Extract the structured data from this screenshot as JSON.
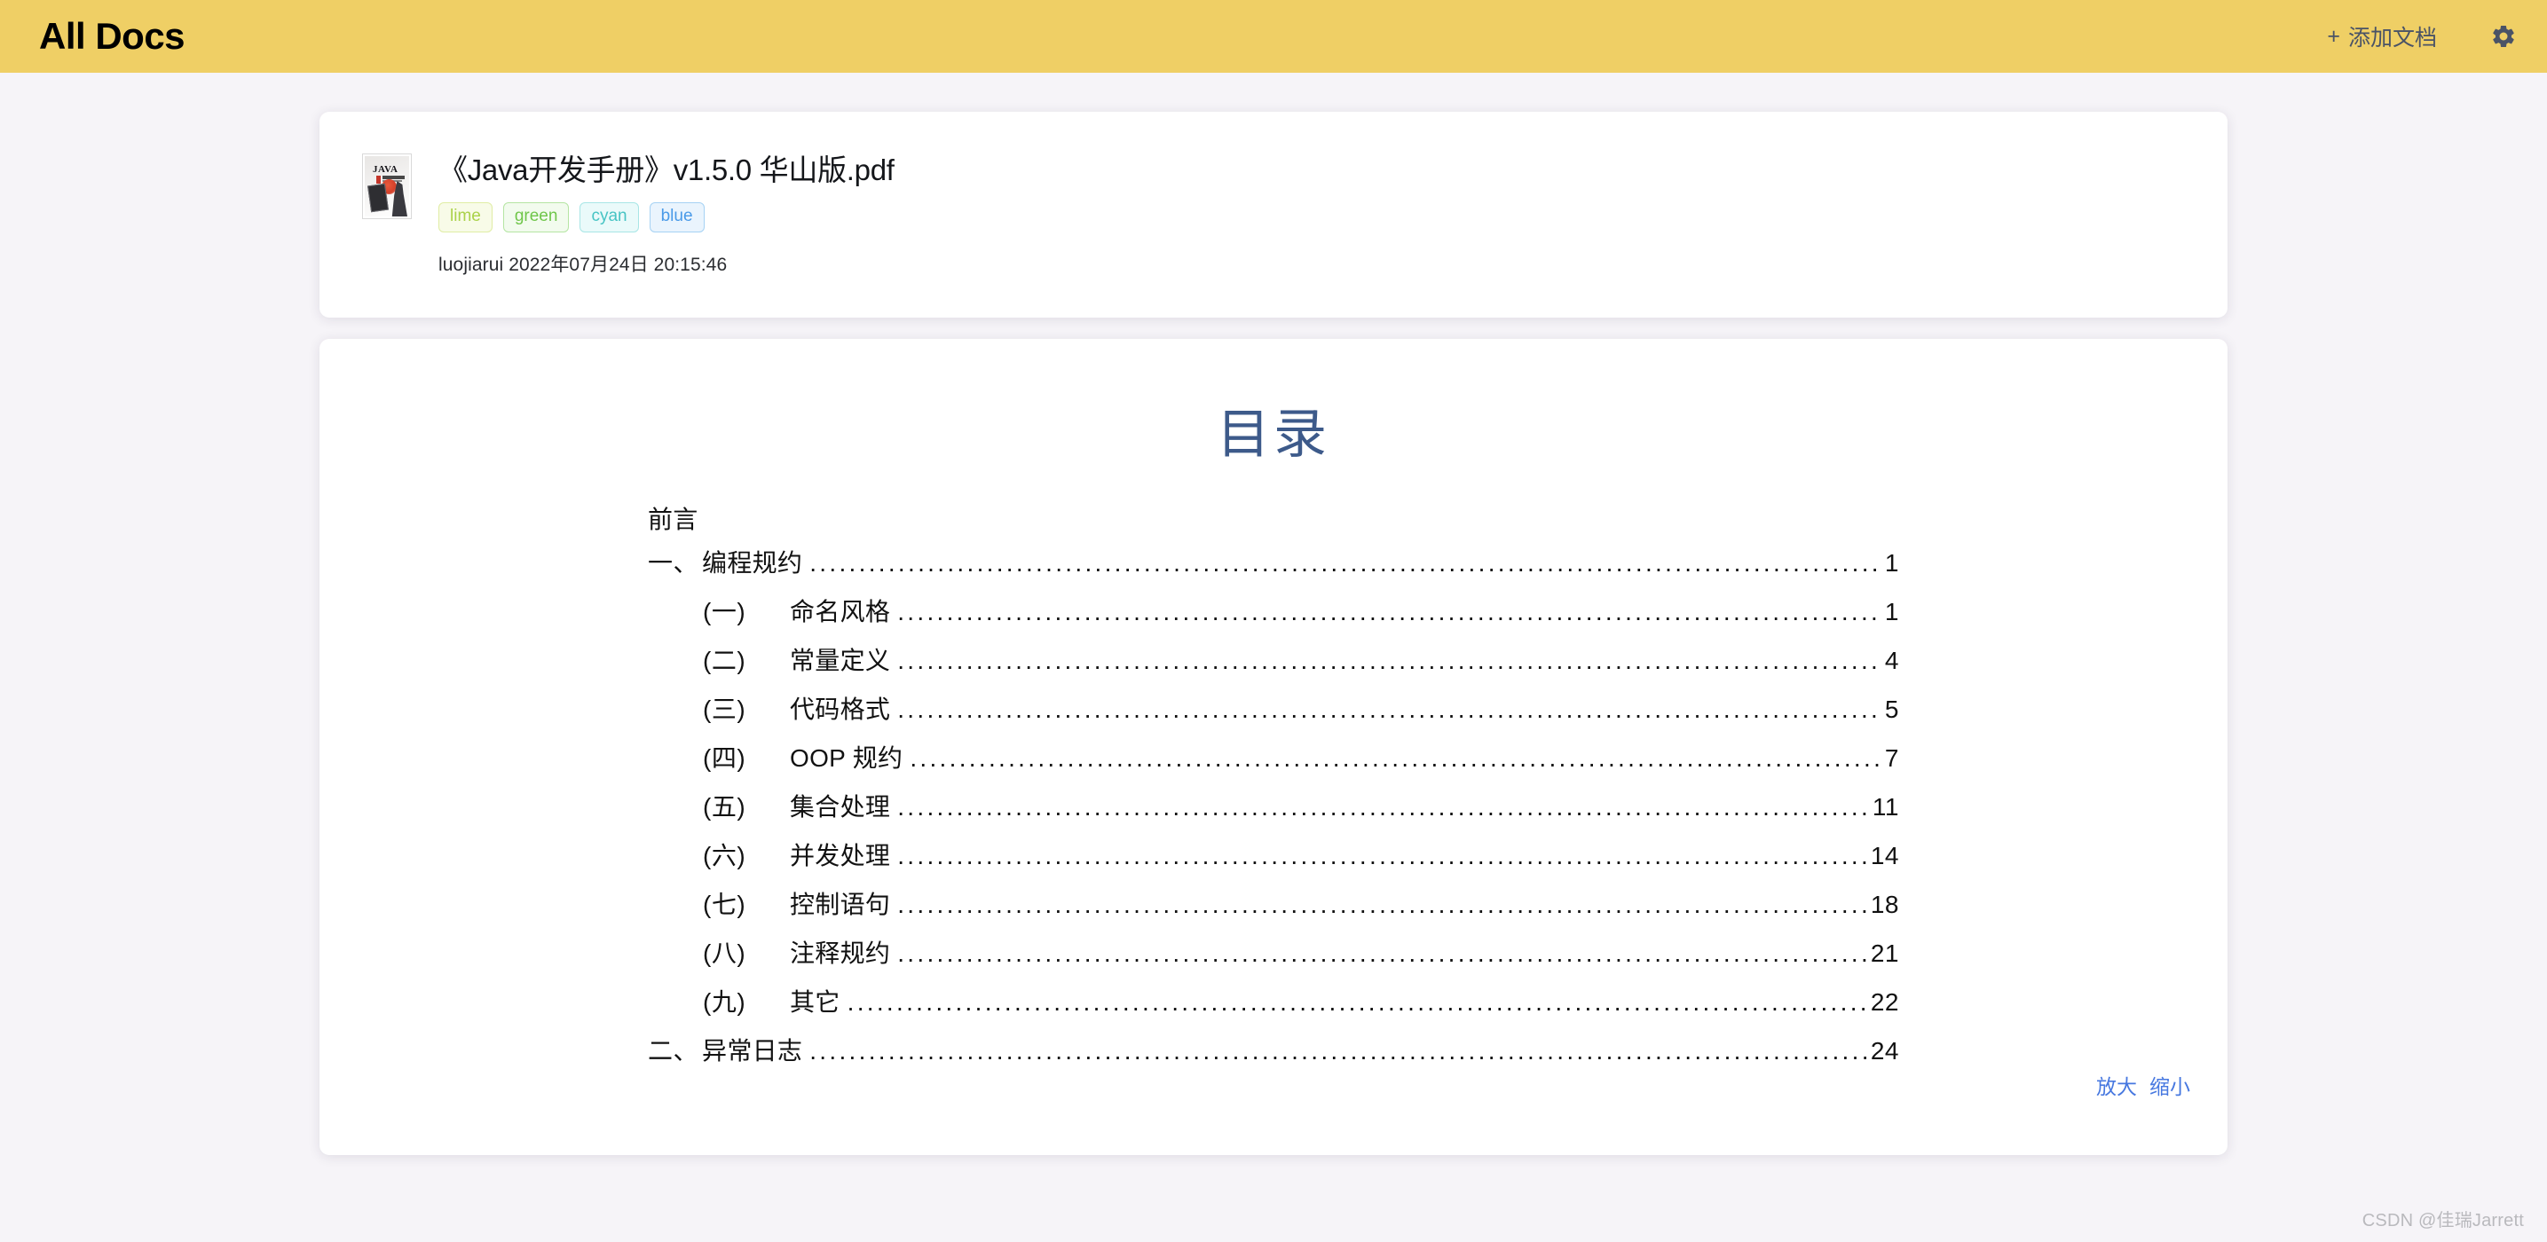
{
  "header": {
    "brand": "All Docs",
    "add_doc_label": "添加文档",
    "add_doc_plus": "+",
    "gear_icon": "gear-icon",
    "bg_color": "#efcf65",
    "text_color": "#4a5366"
  },
  "document": {
    "thumbnail_text": "JAVA",
    "title": "《Java开发手册》v1.5.0 华山版.pdf",
    "tags": [
      {
        "label": "lime",
        "text_color": "#aad24a",
        "bg_color": "#f8fbe8",
        "border_color": "#e0eda4"
      },
      {
        "label": "green",
        "text_color": "#6fc64a",
        "bg_color": "#f2fbee",
        "border_color": "#b5e5a3"
      },
      {
        "label": "cyan",
        "text_color": "#47c4c4",
        "bg_color": "#eafafa",
        "border_color": "#a8e6e6"
      },
      {
        "label": "blue",
        "text_color": "#4a9ae8",
        "bg_color": "#eaf4fd",
        "border_color": "#a6d2f4"
      }
    ],
    "author": "luojiarui",
    "date": "2022年07月24日",
    "time": "20:15:46",
    "meta_line": "luojiarui 2022年07月24日 20:15:46"
  },
  "viewer": {
    "toc_title": "目录",
    "toc_title_color": "#3d5a8a",
    "dot_leader": "..................................................................................................................................................................",
    "entries": [
      {
        "num": "",
        "label": "前言",
        "page": "",
        "level": 1,
        "has_page": false
      },
      {
        "num": "一、",
        "label": "编程规约",
        "page": "1",
        "level": 1,
        "has_page": true
      },
      {
        "num": "(一)",
        "label": "命名风格",
        "page": "1",
        "level": 2,
        "has_page": true
      },
      {
        "num": "(二)",
        "label": "常量定义",
        "page": "4",
        "level": 2,
        "has_page": true
      },
      {
        "num": "(三)",
        "label": "代码格式",
        "page": "5",
        "level": 2,
        "has_page": true
      },
      {
        "num": "(四)",
        "label": "OOP 规约",
        "page": "7",
        "level": 2,
        "has_page": true
      },
      {
        "num": "(五)",
        "label": "集合处理",
        "page": "11",
        "level": 2,
        "has_page": true
      },
      {
        "num": "(六)",
        "label": "并发处理",
        "page": "14",
        "level": 2,
        "has_page": true
      },
      {
        "num": "(七)",
        "label": "控制语句",
        "page": "18",
        "level": 2,
        "has_page": true
      },
      {
        "num": "(八)",
        "label": "注释规约",
        "page": "21",
        "level": 2,
        "has_page": true
      },
      {
        "num": "(九)",
        "label": "其它",
        "page": "22",
        "level": 2,
        "has_page": true
      },
      {
        "num": "二、",
        "label": "异常日志",
        "page": "24",
        "level": 1,
        "has_page": true
      }
    ],
    "zoom_in_label": "放大",
    "zoom_out_label": "缩小",
    "zoom_link_color": "#4778e0"
  },
  "watermark": {
    "text": "CSDN @佳瑞Jarrett"
  }
}
